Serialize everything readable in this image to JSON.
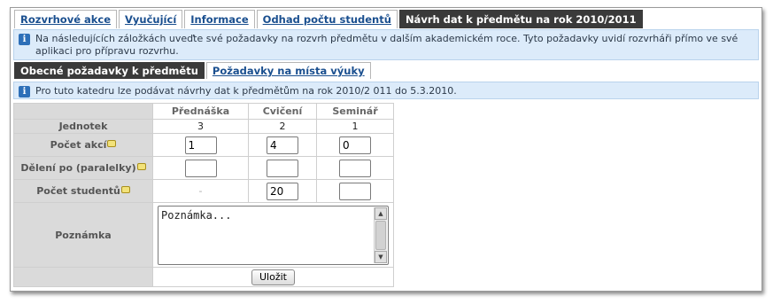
{
  "main_tabs": [
    {
      "label": "Rozvrhové akce",
      "active": false
    },
    {
      "label": "Vyučující",
      "active": false
    },
    {
      "label": "Informace",
      "active": false
    },
    {
      "label": "Odhad počtu studentů",
      "active": false
    },
    {
      "label": "Návrh dat k předmětu na rok 2010/2011",
      "active": true
    }
  ],
  "info_main": "Na následujících záložkách uveďte své požadavky na rozvrh předmětu v dalším akademickém roce. Tyto požadavky uvidí rozvrháři přímo ve své aplikaci pro přípravu rozvrhu.",
  "sub_tabs": [
    {
      "label": "Obecné požadavky k předmětu",
      "active": true
    },
    {
      "label": "Požadavky na místa výuky",
      "active": false
    }
  ],
  "info_dept": "Pro tuto katedru lze podávat návrhy dat k předmětům na rok 2010/2 011 do 5.3.2010.",
  "icons": {
    "info": "info-icon",
    "comment": "comment-icon"
  },
  "table": {
    "columns": [
      "Přednáška",
      "Cvičení",
      "Seminář"
    ],
    "rows": {
      "jednotek": {
        "label": "Jednotek",
        "values": [
          "3",
          "2",
          "1"
        ]
      },
      "pocet_akci": {
        "label": "Počet akcí",
        "values": [
          "1",
          "4",
          "0"
        ]
      },
      "deleni": {
        "label": "Dělení po (paralelky)",
        "values": [
          "",
          "",
          ""
        ]
      },
      "pocet_studentu": {
        "label": "Počet studentů",
        "prednaska_text": "-",
        "values": [
          "",
          "20",
          ""
        ]
      },
      "poznamka": {
        "label": "Poznámka",
        "value": "Poznámka..."
      }
    },
    "save_label": "Uložit"
  },
  "colors": {
    "active_tab": "#3a3a3a",
    "link": "#1a4f8f",
    "info_bg": "#dcebfa",
    "row_label_bg": "#dadada"
  }
}
